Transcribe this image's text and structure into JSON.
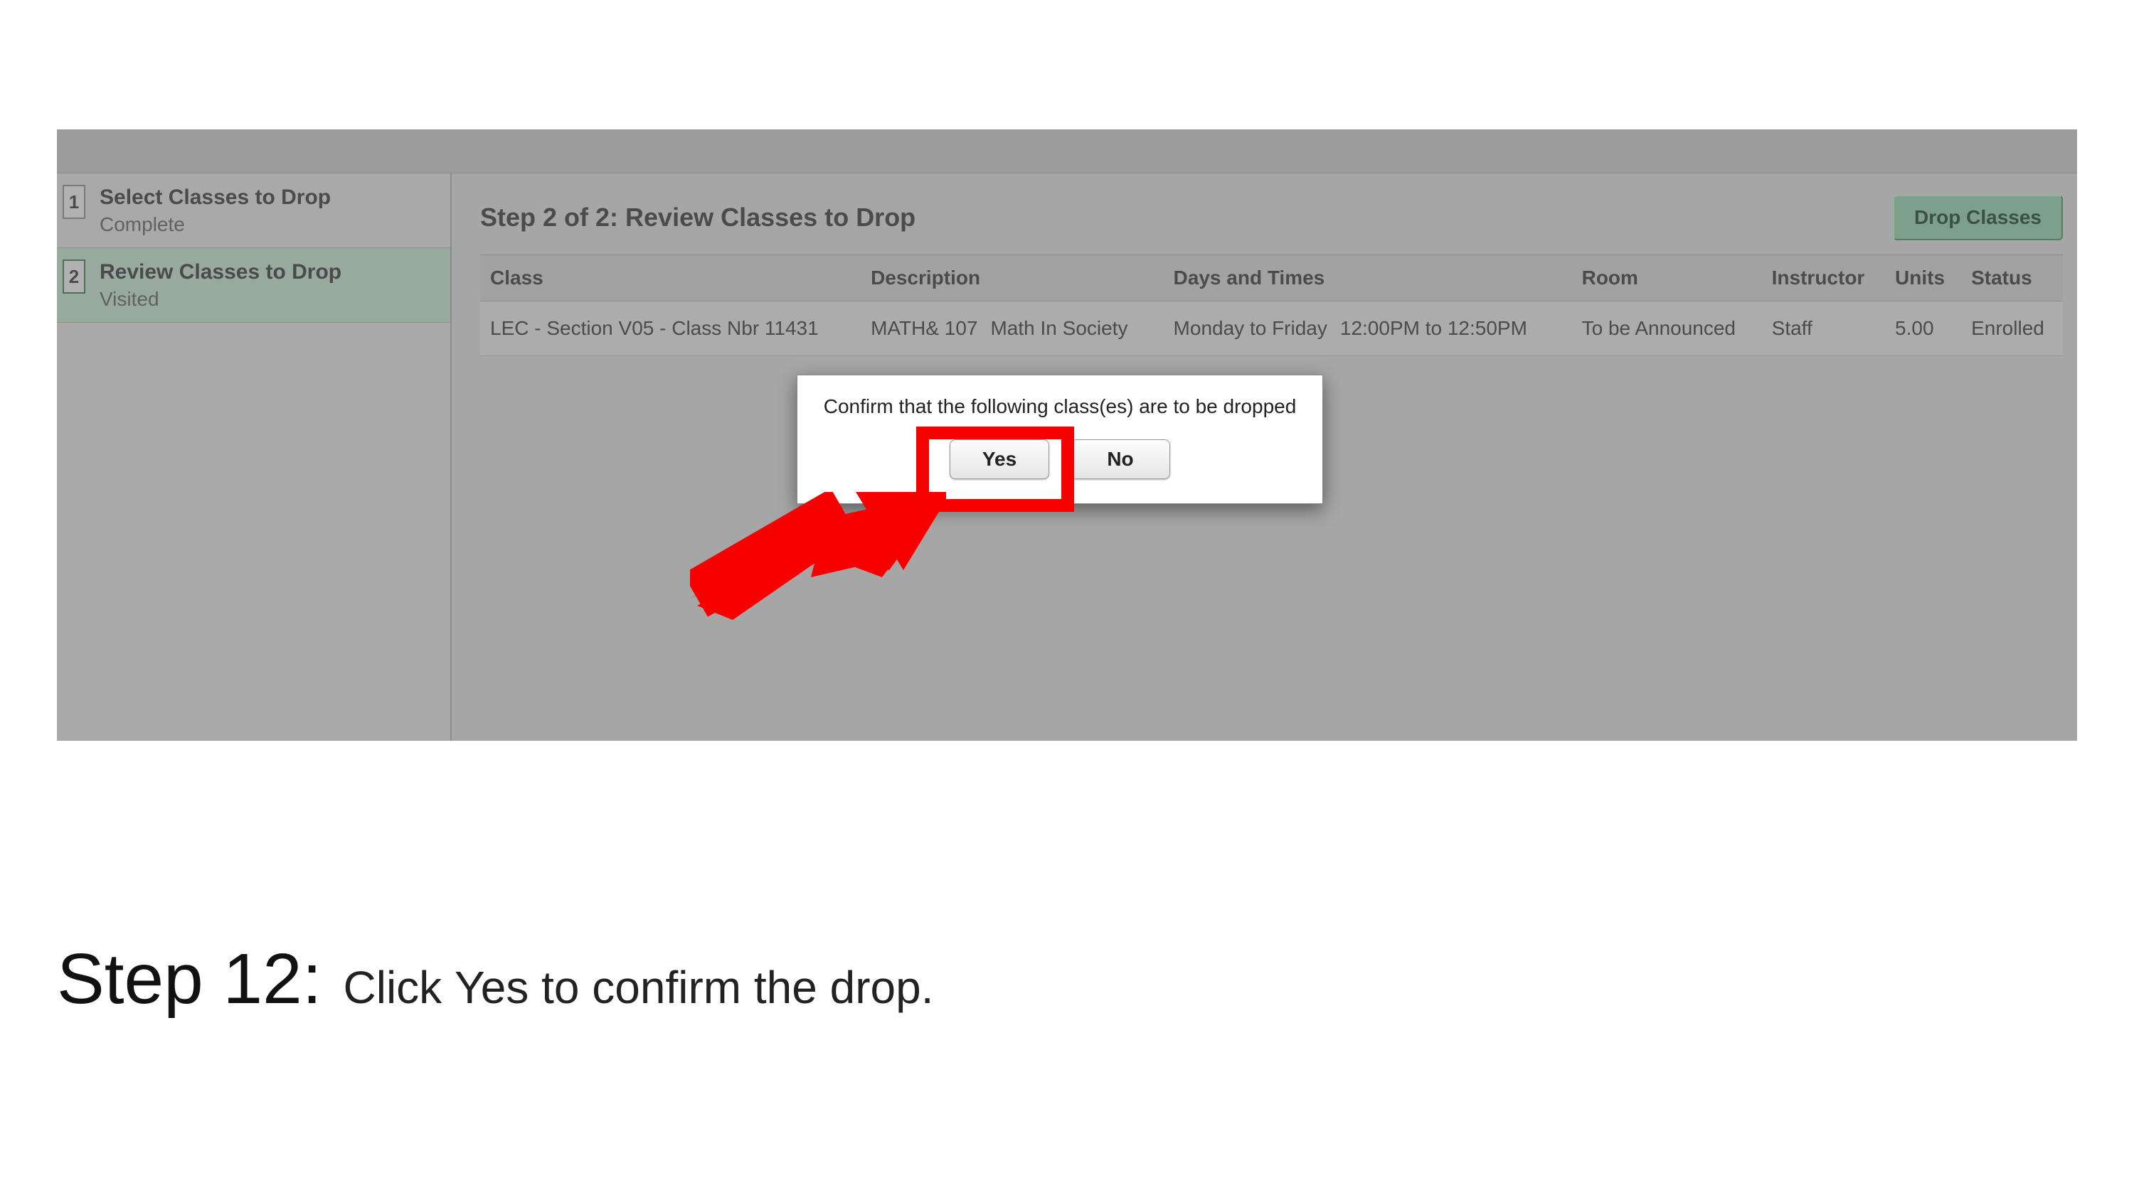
{
  "sidebar": {
    "steps": [
      {
        "num": "1",
        "title": "Select Classes to Drop",
        "status": "Complete"
      },
      {
        "num": "2",
        "title": "Review Classes to Drop",
        "status": "Visited"
      }
    ]
  },
  "main": {
    "title": "Step 2 of 2: Review Classes to Drop",
    "drop_button_label": "Drop Classes",
    "table": {
      "headers": {
        "class": "Class",
        "description": "Description",
        "days_times": "Days and Times",
        "room": "Room",
        "instructor": "Instructor",
        "units": "Units",
        "status": "Status"
      },
      "rows": [
        {
          "class": "LEC - Section V05 - Class Nbr 11431",
          "desc_code": "MATH& 107",
          "desc_title": "Math In Society",
          "days": "Monday to Friday",
          "times": "12:00PM to 12:50PM",
          "room": "To be Announced",
          "instructor": "Staff",
          "units": "5.00",
          "status": "Enrolled"
        }
      ]
    }
  },
  "dialog": {
    "message": "Confirm that the following class(es) are to be dropped",
    "yes_label": "Yes",
    "no_label": "No"
  },
  "caption": {
    "step_label": "Step 12:",
    "text_before": "Click ",
    "keyword": "Yes",
    "text_after": " to confirm the drop."
  },
  "annotation": {
    "highlight_color": "#f80000"
  }
}
